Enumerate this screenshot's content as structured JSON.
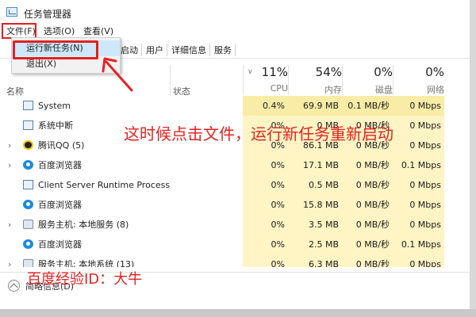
{
  "window": {
    "title": "任务管理器"
  },
  "menubar": {
    "file": "文件(F)",
    "options": "选项(O)",
    "view": "查看(V)"
  },
  "tabs": {
    "startup": "启动",
    "users": "用户",
    "details": "详细信息",
    "services": "服务"
  },
  "file_menu": {
    "run_new_task": "运行新任务(N)",
    "exit": "退出(X)"
  },
  "columns": {
    "name": "名称",
    "status": "状态",
    "cpu": {
      "percent": "11%",
      "label": "CPU"
    },
    "memory": {
      "percent": "54%",
      "label": "内存"
    },
    "disk": {
      "percent": "0%",
      "label": "磁盘"
    },
    "network": {
      "percent": "0%",
      "label": "网络"
    }
  },
  "processes": [
    {
      "name": "System",
      "icon": "system-window-icon",
      "expandable": false,
      "cpu": "0.4%",
      "memory": "69.9 MB",
      "disk": "0.1 MB/秒",
      "network": "0 Mbps"
    },
    {
      "name": "系统中断",
      "icon": "system-window-icon",
      "expandable": false,
      "cpu": "0%",
      "memory": "0 MB",
      "disk": "0 MB/秒",
      "network": "0 Mbps"
    },
    {
      "name": "腾讯QQ (5)",
      "icon": "qq-penguin-icon",
      "expandable": true,
      "cpu": "0%",
      "memory": "86.1 MB",
      "disk": "0 MB/秒",
      "network": "0 Mbps"
    },
    {
      "name": "百度浏览器",
      "icon": "baidu-browser-icon",
      "expandable": true,
      "cpu": "0%",
      "memory": "17.1 MB",
      "disk": "0 MB/秒",
      "network": "0.1 Mbps"
    },
    {
      "name": "Client Server Runtime Process",
      "icon": "system-window-icon",
      "expandable": false,
      "cpu": "0%",
      "memory": "0.5 MB",
      "disk": "0 MB/秒",
      "network": "0 Mbps"
    },
    {
      "name": "百度浏览器",
      "icon": "baidu-browser-icon",
      "expandable": false,
      "cpu": "0%",
      "memory": "15.8 MB",
      "disk": "0 MB/秒",
      "network": "0 Mbps"
    },
    {
      "name": "服务主机: 本地服务 (8)",
      "icon": "service-host-icon",
      "expandable": true,
      "cpu": "0%",
      "memory": "3.5 MB",
      "disk": "0 MB/秒",
      "network": "0 Mbps"
    },
    {
      "name": "百度浏览器",
      "icon": "baidu-browser-icon",
      "expandable": false,
      "cpu": "0%",
      "memory": "2.5 MB",
      "disk": "0 MB/秒",
      "network": "0.1 Mbps"
    },
    {
      "name": "服务主机: 本地系统 (13)",
      "icon": "service-host-icon",
      "expandable": true,
      "cpu": "0%",
      "memory": "6.3 MB",
      "disk": "0 MB/秒",
      "network": "0 Mbps"
    }
  ],
  "footer": {
    "fewer_details": "简略信息(D)"
  },
  "overlay": {
    "annotation": "这时候点击文件，运行新任务重新启动",
    "watermark": "百度经验ID：大牛"
  },
  "colors": {
    "highlight_red": "#e52222",
    "usage_cell": "#fff4c4",
    "menu_hover": "#cde8fa"
  }
}
